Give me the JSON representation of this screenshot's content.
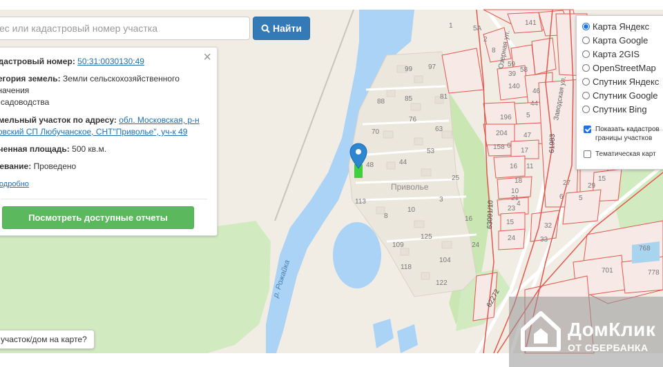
{
  "search": {
    "placeholder": "ес или кадастровый номер участка",
    "button_label": "Найти"
  },
  "info": {
    "cadastral_label": "адастровый номер:",
    "cadastral_value": "50:31:0030130:49",
    "category_label": "тегория земель:",
    "category_value_1": "Земли сельскохозяйственного",
    "category_value_2": "значения",
    "category_value_3": "я садоводства",
    "address_label": "емельный участок по адресу:",
    "address_value_1": "обл. Московская, р-н",
    "address_value_2": "ховский СП Любучанское, СНТ\"Приволье\", уч-к 49",
    "area_label": "ученная площадь:",
    "area_value": "500 кв.м.",
    "survey_label": "жевание:",
    "survey_value": "Проведено",
    "details_link": "Подробно",
    "reports_button": "Посмотреть доступные отчеты"
  },
  "layers": {
    "options": [
      "Карта Яндекс",
      "Карта Google",
      "Карта 2GIS",
      "OpenStreetMap",
      "Спутник Яндекс",
      "Спутник Google",
      "Спутник Bing"
    ],
    "selected": "Карта Яндекс",
    "show_cadastral_1": "Показать кадастров",
    "show_cadastral_2": "границы участков",
    "thematic": "Тематическая карт"
  },
  "question_label": "участок/дом на карте?",
  "watermark": {
    "title": "ДомКлик",
    "subtitle": "ОТ СБЕРБАНКА"
  },
  "map_labels": {
    "settlement": "Приволье",
    "river": "р. Рожайка",
    "street_ozernaya": "Озерная ул.",
    "street_zavodskaya": "Заводская ул.",
    "plot_numbers": [
      "99",
      "97",
      "88",
      "85",
      "81",
      "76",
      "70",
      "63",
      "53",
      "48",
      "44",
      "25",
      "113",
      "3",
      "10",
      "8",
      "16",
      "125",
      "109",
      "24",
      "104",
      "118",
      "122",
      "1",
      "5А",
      "2",
      "141",
      "8",
      "59",
      "39",
      "58",
      "140",
      "46",
      "44",
      "196",
      "5",
      "204",
      "47",
      "158",
      "6",
      "17",
      "11",
      "16",
      "18",
      "10",
      "21",
      "4",
      "27",
      "5",
      "23",
      "15",
      "32",
      "24",
      "33",
      "6",
      "29",
      "15",
      "768",
      "701",
      "778"
    ],
    "cadastral_numbers": [
      "61983",
      "63091/10",
      "62272"
    ]
  },
  "colors": {
    "water": "#aad3f5",
    "park": "#d2eac0",
    "parcel_line": "#e2574c",
    "selected_parcel": "#3ed13e",
    "marker": "#2e86d1",
    "button_primary": "#337ab7",
    "button_success": "#5cb85c"
  }
}
